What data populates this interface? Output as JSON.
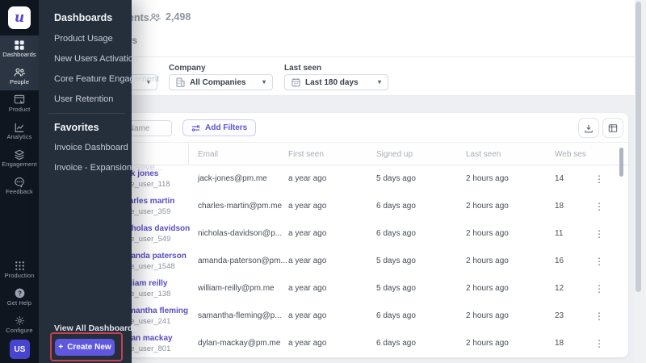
{
  "colors": {
    "accent": "#5f57e0",
    "sidebar_bg": "#10161f",
    "flyout_bg": "#252e3b",
    "annotation_red": "#c9404f",
    "name_link": "#584fc4",
    "page_bg": "#edeff2"
  },
  "brand": {
    "logo_letter": "u"
  },
  "icons": {
    "kebab": "⋮",
    "chevron_down": "▾",
    "plus": "+",
    "question": "?"
  },
  "sidebar": {
    "items": [
      {
        "label": "Dashboards"
      },
      {
        "label": "People"
      },
      {
        "label": "Product"
      },
      {
        "label": "Analytics"
      },
      {
        "label": "Engagement"
      },
      {
        "label": "Feedback"
      }
    ],
    "bottom_items": [
      {
        "label": "Production"
      },
      {
        "label": "Get Help"
      },
      {
        "label": "Configure"
      }
    ],
    "avatar_label": "US"
  },
  "flyout": {
    "title": "Dashboards",
    "items": [
      {
        "label": "Product Usage"
      },
      {
        "label": "New Users Activation"
      },
      {
        "label": "Core Feature Engagement"
      },
      {
        "label": "User Retention"
      }
    ],
    "favorites_title": "Favorites",
    "favorites": [
      {
        "label": "Invoice Dashboard"
      },
      {
        "label": "Invoice - Expansion Reve..."
      }
    ],
    "view_all_label": "View All Dashboards",
    "create_new_label": "Create New"
  },
  "header": {
    "title": "Segments",
    "users_count": "2,498",
    "tab_label": "Users"
  },
  "filters": {
    "company_label": "Company",
    "company_value": "All Companies",
    "last_seen_label": "Last seen",
    "last_seen_value": "Last 180 days"
  },
  "toolbar": {
    "search_placeholder": "Search by Name",
    "add_filters_label": "Add Filters"
  },
  "table": {
    "columns": {
      "email": "Email",
      "first_seen": "First seen",
      "signed_up": "Signed up",
      "last_seen": "Last seen",
      "web_sessions": "Web ses"
    },
    "rows": [
      {
        "name": "jack jones",
        "user_id": "core_user_118",
        "email": "jack-jones@pm.me",
        "first_seen": "a year ago",
        "signed_up": "5 days ago",
        "last_seen": "2 hours ago",
        "web_sessions": "14"
      },
      {
        "name": "charles martin",
        "user_id": "core_user_359",
        "email": "charles-martin@pm.me",
        "first_seen": "a year ago",
        "signed_up": "6 days ago",
        "last_seen": "2 hours ago",
        "web_sessions": "18"
      },
      {
        "name": "nicholas davidson",
        "user_id": "core_user_549",
        "email": "nicholas-davidson@p...",
        "first_seen": "a year ago",
        "signed_up": "6 days ago",
        "last_seen": "2 hours ago",
        "web_sessions": "11"
      },
      {
        "name": "amanda paterson",
        "user_id": "core_user_1548",
        "email": "amanda-paterson@pm...",
        "first_seen": "a year ago",
        "signed_up": "5 days ago",
        "last_seen": "2 hours ago",
        "web_sessions": "16"
      },
      {
        "name": "william reilly",
        "user_id": "core_user_138",
        "email": "william-reilly@pm.me",
        "first_seen": "a year ago",
        "signed_up": "5 days ago",
        "last_seen": "2 hours ago",
        "web_sessions": "12"
      },
      {
        "name": "samantha fleming",
        "user_id": "core_user_241",
        "email": "samantha-fleming@p...",
        "first_seen": "a year ago",
        "signed_up": "6 days ago",
        "last_seen": "2 hours ago",
        "web_sessions": "23"
      },
      {
        "name": "dylan mackay",
        "user_id": "core_user_801",
        "email": "dylan-mackay@pm.me",
        "first_seen": "a year ago",
        "signed_up": "6 days ago",
        "last_seen": "2 hours ago",
        "web_sessions": "18"
      }
    ]
  }
}
